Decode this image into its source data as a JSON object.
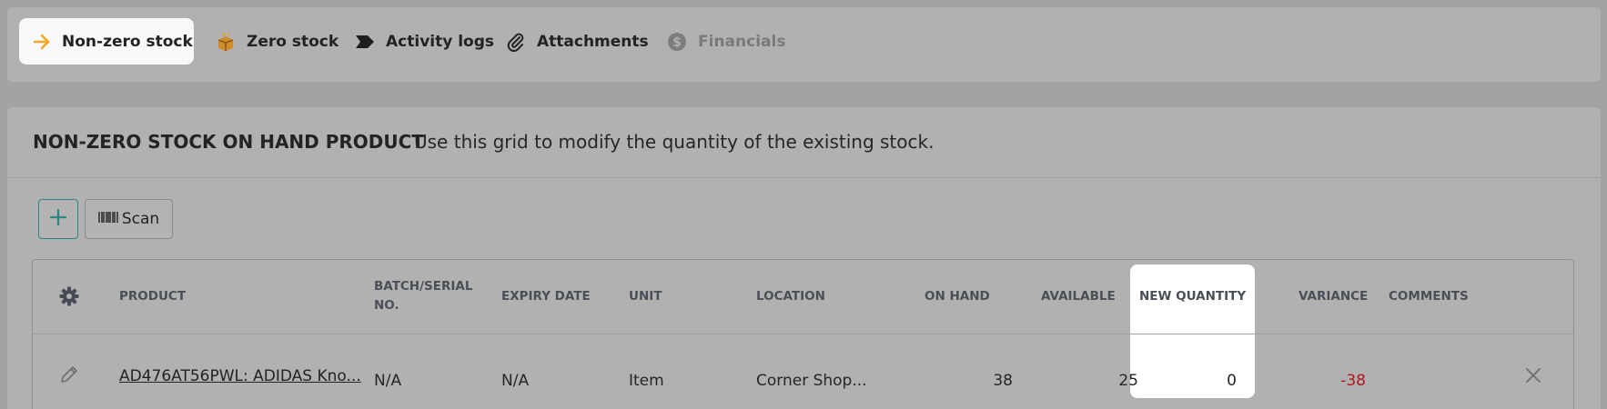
{
  "tabs": [
    {
      "label": "Non-zero stock",
      "icon": "arrow-right-icon",
      "active": true
    },
    {
      "label": "Zero stock",
      "icon": "box-icon"
    },
    {
      "label": "Activity logs",
      "icon": "tag-icon"
    },
    {
      "label": "Attachments",
      "icon": "paperclip-icon"
    },
    {
      "label": "Financials",
      "icon": "dollar-icon",
      "disabled": true
    }
  ],
  "panel": {
    "title": "NON-ZERO STOCK ON HAND PRODUCT",
    "description": "Use this grid to modify the quantity of the existing stock."
  },
  "toolbar": {
    "add_icon": "plus-icon",
    "scan_label": "Scan",
    "scan_icon": "barcode-icon"
  },
  "grid": {
    "columns": {
      "product": "PRODUCT",
      "batch_line1": "BATCH/SERIAL",
      "batch_line2": "NO.",
      "expiry": "EXPIRY DATE",
      "unit": "UNIT",
      "location": "LOCATION",
      "on_hand": "ON HAND",
      "available": "AVAILABLE",
      "new_quantity": "NEW QUANTITY",
      "variance": "VARIANCE",
      "comments": "COMMENTS"
    },
    "rows": [
      {
        "product": "AD476AT56PWL: ADIDAS Kno...",
        "batch": "N/A",
        "expiry": "N/A",
        "unit": "Item",
        "location": "Corner Shop...",
        "on_hand": "38",
        "available": "25",
        "new_quantity": "0",
        "variance": "-38",
        "comments": ""
      }
    ]
  },
  "colors": {
    "accent": "#f5a623",
    "add_border": "#2e8680",
    "negative": "#b3151c"
  }
}
